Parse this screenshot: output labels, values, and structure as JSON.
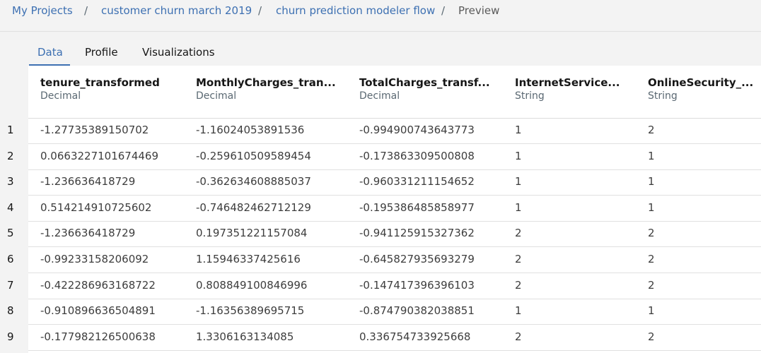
{
  "breadcrumb": {
    "items": [
      "My Projects",
      "customer churn march 2019",
      "churn prediction modeler flow"
    ],
    "current": "Preview",
    "separator": "/"
  },
  "tabs": [
    "Data",
    "Profile",
    "Visualizations"
  ],
  "active_tab": "Data",
  "columns": [
    {
      "name": "tenure_transformed",
      "type": "Decimal"
    },
    {
      "name": "MonthlyCharges_tran...",
      "type": "Decimal"
    },
    {
      "name": "TotalCharges_transf...",
      "type": "Decimal"
    },
    {
      "name": "InternetService...",
      "type": "String"
    },
    {
      "name": "OnlineSecurity_...",
      "type": "String"
    }
  ],
  "rows": [
    {
      "n": "1",
      "cells": [
        "-1.27735389150702",
        "-1.16024053891536",
        "-0.994900743643773",
        "1",
        "2"
      ]
    },
    {
      "n": "2",
      "cells": [
        "0.0663227101674469",
        "-0.259610509589454",
        "-0.173863309500808",
        "1",
        "1"
      ]
    },
    {
      "n": "3",
      "cells": [
        "-1.236636418729",
        "-0.362634608885037",
        "-0.960331211154652",
        "1",
        "1"
      ]
    },
    {
      "n": "4",
      "cells": [
        "0.514214910725602",
        "-0.746482462712129",
        "-0.195386485858977",
        "1",
        "1"
      ]
    },
    {
      "n": "5",
      "cells": [
        "-1.236636418729",
        "0.197351221157084",
        "-0.941125915327362",
        "2",
        "2"
      ]
    },
    {
      "n": "6",
      "cells": [
        "-0.99233158206092",
        "1.15946337425616",
        "-0.645827935693279",
        "2",
        "2"
      ]
    },
    {
      "n": "7",
      "cells": [
        "-0.422286963168722",
        "0.808849100846996",
        "-0.147417396396103",
        "2",
        "2"
      ]
    },
    {
      "n": "8",
      "cells": [
        "-0.910896636504891",
        "-1.16356389695715",
        "-0.874790382038851",
        "1",
        "1"
      ]
    },
    {
      "n": "9",
      "cells": [
        "-0.177982126500638",
        "1.3306163134085",
        "0.336754733925668",
        "2",
        "2"
      ]
    }
  ],
  "colors": {
    "accent": "#3d70b2",
    "background": "#f3f3f3",
    "grid": "#ffffff"
  }
}
